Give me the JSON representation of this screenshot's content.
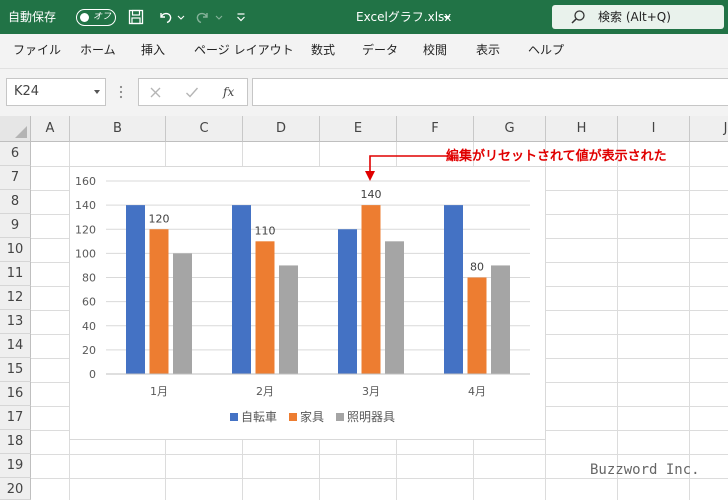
{
  "titlebar": {
    "autosave_label": "自動保存",
    "autosave_state": "オフ",
    "filename": "Excelグラフ.xlsx",
    "search_label": "検索 (Alt+Q)"
  },
  "menu": [
    "ファイル",
    "ホーム",
    "挿入",
    "ページ レイアウト",
    "数式",
    "データ",
    "校閲",
    "表示",
    "ヘルプ"
  ],
  "formula_bar": {
    "name_box": "K24",
    "fx": "fx",
    "value": ""
  },
  "columns": [
    "A",
    "B",
    "C",
    "D",
    "E",
    "F",
    "G",
    "H",
    "I",
    "J"
  ],
  "rows": [
    "6",
    "7",
    "8",
    "9",
    "10",
    "11",
    "12",
    "13",
    "14",
    "15",
    "16",
    "17",
    "18",
    "19",
    "20"
  ],
  "chart_data": {
    "type": "bar",
    "categories": [
      "1月",
      "2月",
      "3月",
      "4月"
    ],
    "series": [
      {
        "name": "自転車",
        "color": "#4472c4",
        "values": [
          140,
          140,
          120,
          140
        ]
      },
      {
        "name": "家具",
        "color": "#ed7d31",
        "values": [
          120,
          110,
          140,
          80
        ]
      },
      {
        "name": "照明器具",
        "color": "#a5a5a5",
        "values": [
          100,
          90,
          110,
          90
        ]
      }
    ],
    "data_labels": [
      {
        "series": 1,
        "category": 0,
        "text": "120"
      },
      {
        "series": 1,
        "category": 1,
        "text": "110"
      },
      {
        "series": 1,
        "category": 2,
        "text": "140"
      },
      {
        "series": 1,
        "category": 3,
        "text": "80"
      }
    ],
    "yticks": [
      "0",
      "20",
      "40",
      "60",
      "80",
      "100",
      "120",
      "140",
      "160"
    ],
    "ylim": [
      0,
      160
    ],
    "grid": true,
    "legend": "bottom"
  },
  "annotation": "編集がリセットされて値が表示された",
  "watermark": "Buzzword Inc."
}
